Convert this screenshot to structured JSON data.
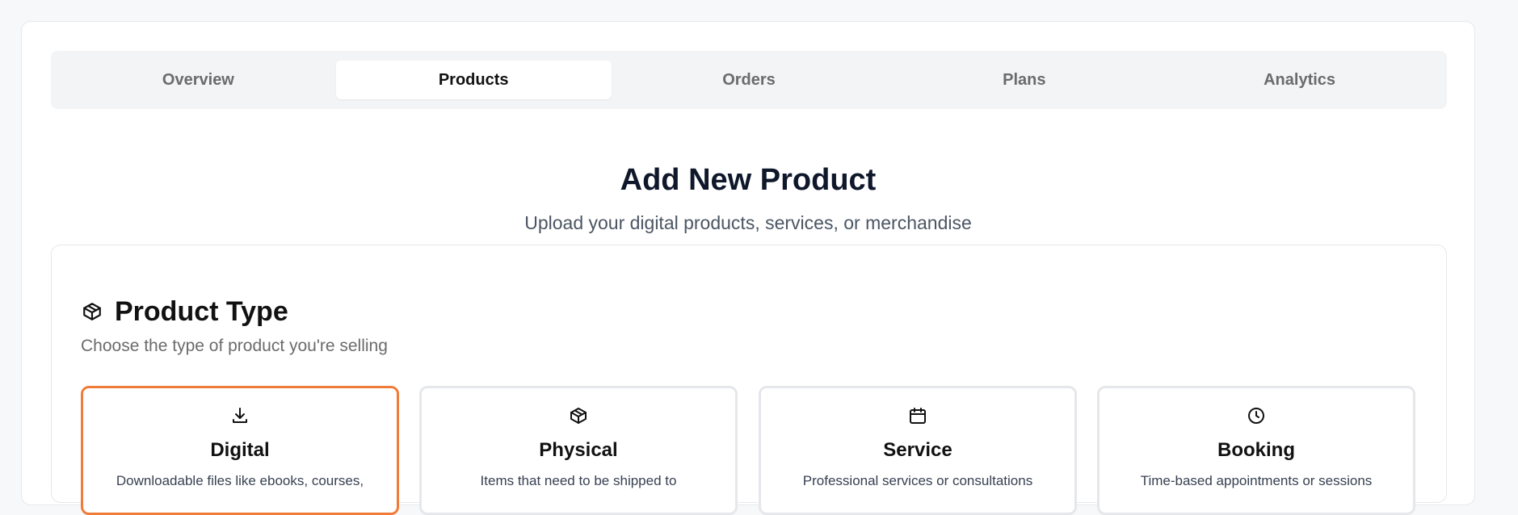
{
  "tabs": {
    "items": [
      {
        "label": "Overview"
      },
      {
        "label": "Products"
      },
      {
        "label": "Orders"
      },
      {
        "label": "Plans"
      },
      {
        "label": "Analytics"
      }
    ],
    "active": "Products"
  },
  "header": {
    "title": "Add New Product",
    "subtitle": "Upload your digital products, services, or merchandise"
  },
  "product_type": {
    "icon": "box-icon",
    "title": "Product Type",
    "subtitle": "Choose the type of product you're selling",
    "options": [
      {
        "icon": "download-icon",
        "title": "Digital",
        "description": "Downloadable files like ebooks, courses,",
        "selected": true
      },
      {
        "icon": "box-icon",
        "title": "Physical",
        "description": "Items that need to be shipped to",
        "selected": false
      },
      {
        "icon": "calendar-icon",
        "title": "Service",
        "description": "Professional services or consultations",
        "selected": false
      },
      {
        "icon": "clock-icon",
        "title": "Booking",
        "description": "Time-based appointments or sessions",
        "selected": false
      }
    ]
  },
  "colors": {
    "accent_selected_border": "#f07c3a",
    "tab_bar_bg": "#f3f4f6",
    "active_tab_bg": "#ffffff"
  }
}
